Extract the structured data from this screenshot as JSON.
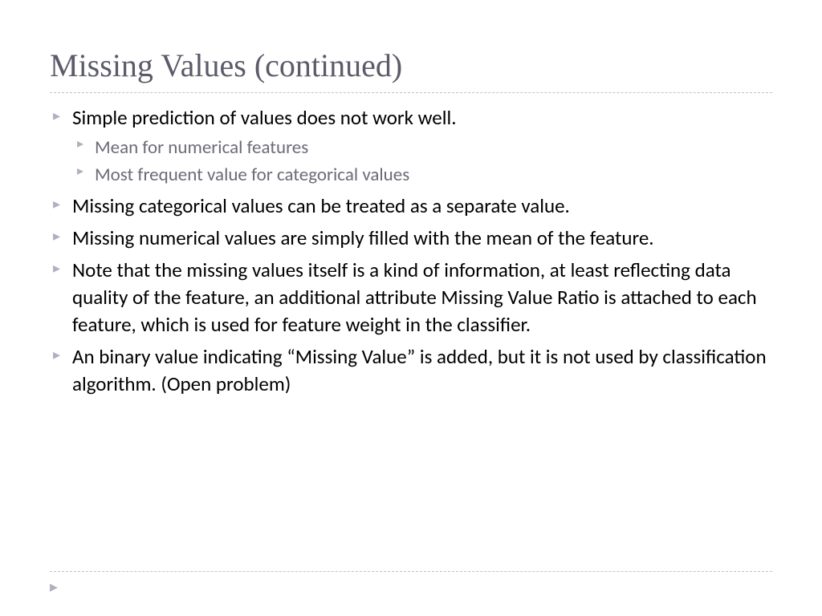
{
  "title": "Missing Values (continued)",
  "bullets": [
    {
      "text": "Simple prediction of values does not work well.",
      "sub": [
        "Mean for numerical features",
        "Most frequent value for categorical values"
      ]
    },
    {
      "text": "Missing categorical values can be treated as a separate value."
    },
    {
      "text": "Missing numerical values are simply filled with the mean of the feature."
    },
    {
      "text": "Note that the missing values itself is a kind of information, at least reflecting data quality of the feature, an additional attribute Missing Value Ratio is attached to each feature, which is used for feature weight in the classifier."
    },
    {
      "text": "An binary value indicating “Missing Value” is added, but it is not used by classification algorithm. (Open problem)"
    }
  ]
}
